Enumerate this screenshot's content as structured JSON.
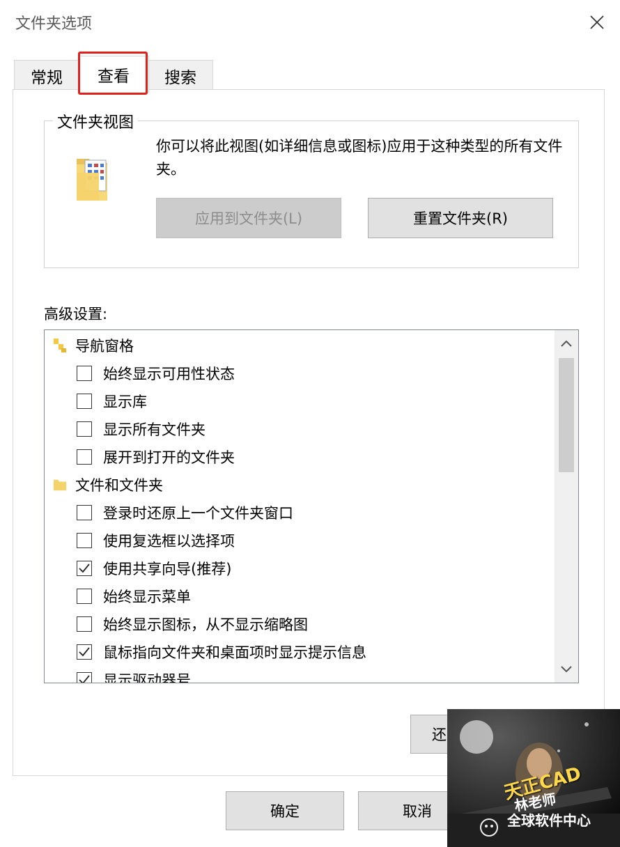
{
  "window": {
    "title": "文件夹选项"
  },
  "tabs": [
    {
      "label": "常规"
    },
    {
      "label": "查看"
    },
    {
      "label": "搜索"
    }
  ],
  "folder_view": {
    "legend": "文件夹视图",
    "description": "你可以将此视图(如详细信息或图标)应用于这种类型的所有文件夹。",
    "apply_button": "应用到文件夹(L)",
    "reset_button": "重置文件夹(R)"
  },
  "advanced": {
    "label": "高级设置:",
    "items": [
      {
        "type": "category",
        "label": "导航窗格",
        "icon": "navigation-pane-icon"
      },
      {
        "type": "option",
        "label": "始终显示可用性状态",
        "checked": false
      },
      {
        "type": "option",
        "label": "显示库",
        "checked": false
      },
      {
        "type": "option",
        "label": "显示所有文件夹",
        "checked": false
      },
      {
        "type": "option",
        "label": "展开到打开的文件夹",
        "checked": false
      },
      {
        "type": "category",
        "label": "文件和文件夹",
        "icon": "folder-icon"
      },
      {
        "type": "option",
        "label": "登录时还原上一个文件夹窗口",
        "checked": false
      },
      {
        "type": "option",
        "label": "使用复选框以选择项",
        "checked": false
      },
      {
        "type": "option",
        "label": "使用共享向导(推荐)",
        "checked": true
      },
      {
        "type": "option",
        "label": "始终显示菜单",
        "checked": false
      },
      {
        "type": "option",
        "label": "始终显示图标，从不显示缩略图",
        "checked": false
      },
      {
        "type": "option",
        "label": "鼠标指向文件夹和桌面项时显示提示信息",
        "checked": true
      },
      {
        "type": "option",
        "label": "显示驱动器号",
        "checked": true
      }
    ]
  },
  "restore_button": "还",
  "footer": {
    "ok_button": "确定",
    "cancel_button": "取消"
  },
  "watermark": {
    "logo_text": "天正CAD",
    "sub_text": "林老师",
    "account": "全球软件中心"
  },
  "colors": {
    "highlight": "#e0201b",
    "disabled_text": "#8d8d8d",
    "folder_yellow": "#f5d36b"
  }
}
